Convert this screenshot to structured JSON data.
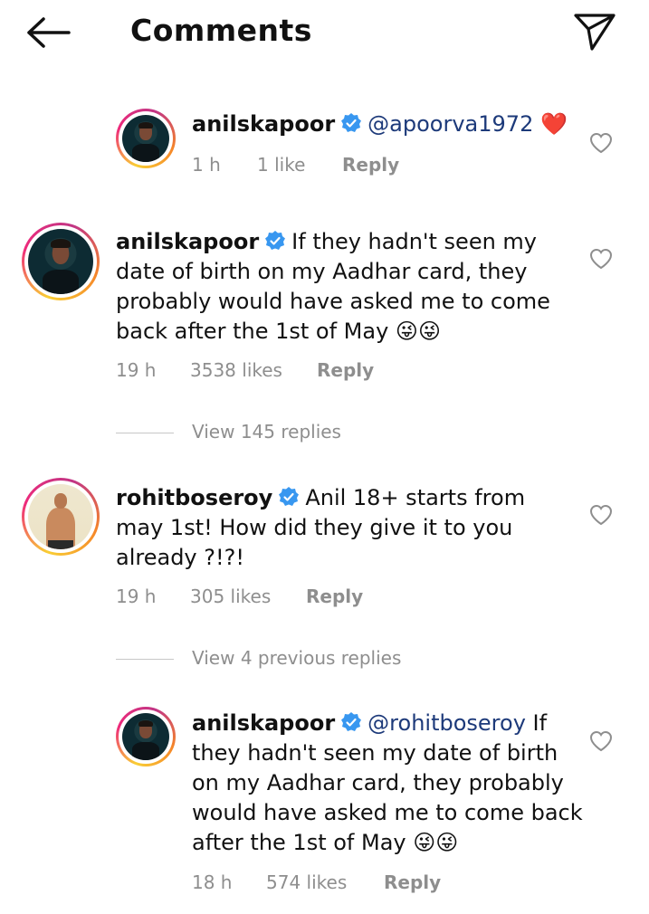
{
  "header": {
    "title": "Comments",
    "back_icon": "arrow-left-icon",
    "send_icon": "paper-plane-icon"
  },
  "colors": {
    "verified": "#3897f0",
    "mention": "#1d3a7a",
    "meta": "#8e8e8e",
    "heart_emoji": "#e0245e"
  },
  "comments": [
    {
      "username": "anilskapoor",
      "verified": true,
      "mention": "@apoorva1972",
      "text": "",
      "emoji": "❤️",
      "time": "1 h",
      "likes": "1 like",
      "reply": "Reply"
    },
    {
      "username": "anilskapoor",
      "verified": true,
      "text_lines": [
        "If they hadn't seen my",
        "date of birth on my Aadhar card, they",
        "probably would have asked me to come",
        "back after the 1st of May"
      ],
      "emoji": "😜😜",
      "time": "19 h",
      "likes": "3538 likes",
      "reply": "Reply",
      "view_replies": "View 145 replies"
    },
    {
      "username": "rohitboseroy",
      "verified": true,
      "text_lines": [
        "Anil 18+ starts from",
        "may 1st! How did they give it to you",
        "already ?!?!"
      ],
      "time": "19 h",
      "likes": "305 likes",
      "reply": "Reply",
      "view_replies": "View 4 previous replies"
    },
    {
      "username": "anilskapoor",
      "verified": true,
      "mention": "@rohitboseroy",
      "text_lines": [
        "If",
        "they hadn't seen my date of birth",
        "on my Aadhar card, they probably",
        "would have asked me to come back",
        "after the 1st of May"
      ],
      "emoji": "😜😜",
      "time": "18 h",
      "likes": "574 likes",
      "reply": "Reply"
    }
  ]
}
